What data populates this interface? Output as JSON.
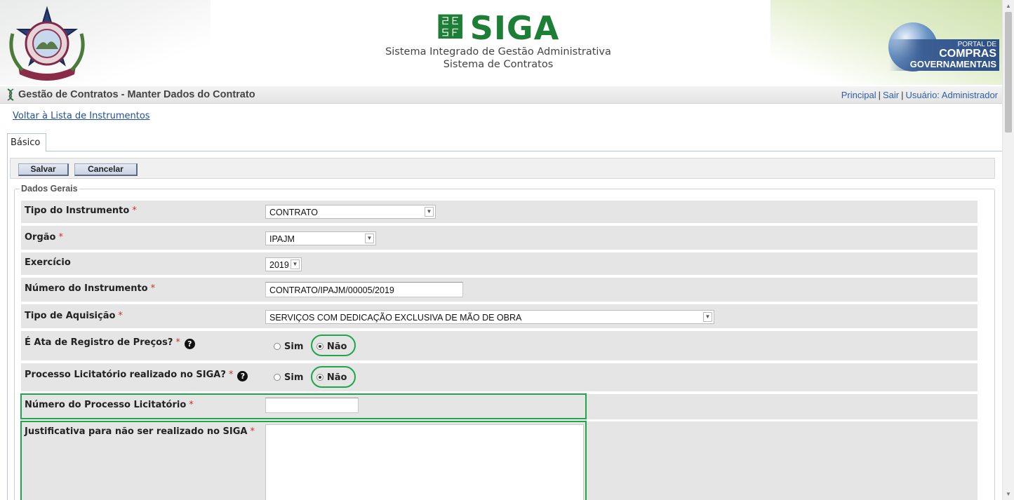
{
  "banner": {
    "brand": "SIGA",
    "subtitle_1": "Sistema Integrado de Gestão Administrativa",
    "subtitle_2": "Sistema de Contratos",
    "portal_l1": "PORTAL DE",
    "portal_l2": "COMPRAS",
    "portal_l3": "GOVERNAMENTAIS"
  },
  "titlebar": {
    "title": "Gestão de Contratos - Manter Dados do Contrato",
    "links": {
      "principal": "Principal",
      "sair": "Sair",
      "usuario": "Usuário: Administrador",
      "sep": "|"
    }
  },
  "back_link": "Voltar à Lista de Instrumentos",
  "tab": "Básico",
  "toolbar": {
    "save_label": "Salvar",
    "cancel_label": "Cancelar"
  },
  "fieldset_legend": "Dados Gerais",
  "required_mark": "*",
  "help_glyph": "?",
  "form": {
    "tipo_instrumento": {
      "label": "Tipo do Instrumento",
      "value": "CONTRATO"
    },
    "orgao": {
      "label": "Orgão",
      "value": "IPAJM"
    },
    "exercicio": {
      "label": "Exercício",
      "value": "2019"
    },
    "numero_instrumento": {
      "label": "Número do Instrumento",
      "value": "CONTRATO/IPAJM/00005/2019"
    },
    "tipo_aquisicao": {
      "label": "Tipo de Aquisição",
      "value": "SERVIÇOS COM DEDICAÇÃO EXCLUSIVA DE MÃO DE OBRA"
    },
    "ata_registro": {
      "label": "É Ata de Registro de Preços?",
      "opt_sim": "Sim",
      "opt_nao": "Não",
      "selected": "Não"
    },
    "processo_siga": {
      "label": "Processo Licitatório realizado no SIGA?",
      "opt_sim": "Sim",
      "opt_nao": "Não",
      "selected": "Não"
    },
    "numero_processo": {
      "label": "Número do Processo Licitatório",
      "value": ""
    },
    "justificativa": {
      "label": "Justificativa para não ser realizado no SIGA",
      "value": ""
    }
  },
  "colors": {
    "accent_green": "#1fa64a",
    "link_blue": "#2e5fa8",
    "required_red": "#d03030",
    "row_gray": "#e5e5e5"
  },
  "icons": [
    "siga-dna-icon",
    "help-icon",
    "dropdown-arrow-icon",
    "radio-icon"
  ]
}
